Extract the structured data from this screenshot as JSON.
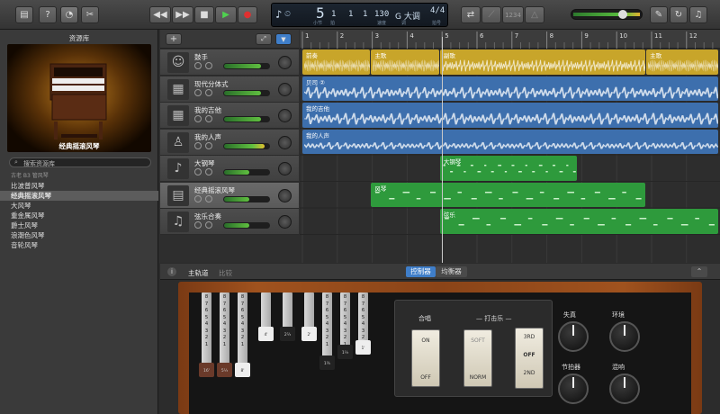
{
  "toolbar": {
    "lcd": {
      "bar": "5",
      "beat": "1",
      "div": "1",
      "tick": "1",
      "bar_label": "小节",
      "beat_label": "拍",
      "tempo": "130",
      "tempo_label": "速度",
      "key": "G 大调",
      "key_label": "调",
      "signature": "4/4",
      "signature_label": "拍号"
    },
    "count_in": "1234"
  },
  "library": {
    "title": "资源库",
    "preview_name": "经典摇滚风琴",
    "search_placeholder": "搜索资源库",
    "breadcrumb": "古老 B3 管风琴",
    "items": [
      "比波普风琴",
      "经典摇滚风琴",
      "大风琴",
      "重金属风琴",
      "爵士风琴",
      "浪潮色风琴",
      "音轮风琴"
    ],
    "selected_index": 1
  },
  "tracks": [
    {
      "name": "鼓手",
      "icon": "drummer-icon",
      "level": 0.82
    },
    {
      "name": "现代分体式",
      "icon": "amp-icon",
      "level": 0.82
    },
    {
      "name": "我的吉他",
      "icon": "amp-icon",
      "level": 0.82
    },
    {
      "name": "我的人声",
      "icon": "mic-icon",
      "level": 0.9
    },
    {
      "name": "大钢琴",
      "icon": "piano-icon",
      "level": 0.55
    },
    {
      "name": "经典摇滚风琴",
      "icon": "organ-icon",
      "level": 0.55
    },
    {
      "name": "弦乐合奏",
      "icon": "strings-icon",
      "level": 0.55
    }
  ],
  "ruler": [
    "1",
    "2",
    "3",
    "4",
    "5",
    "6",
    "7",
    "8",
    "9",
    "10",
    "11",
    "12"
  ],
  "regions": [
    {
      "label": "前奏",
      "track": 0,
      "color": "#c8a52a"
    },
    {
      "label": "主歌",
      "track": 0,
      "color": "#c8a52a"
    },
    {
      "label": "副歌",
      "track": 0,
      "color": "#c8a52a"
    },
    {
      "label": "主歌",
      "track": 0,
      "color": "#c8a52a"
    },
    {
      "label": "贝司 ②",
      "track": 1,
      "color": "#3d6fad"
    },
    {
      "label": "我的吉他",
      "track": 2,
      "color": "#3d6fad"
    },
    {
      "label": "我的人声",
      "track": 3,
      "color": "#3d6fad"
    },
    {
      "label": "大钢琴",
      "track": 4,
      "color": "#2e9a3c"
    },
    {
      "label": "风琴",
      "track": 5,
      "color": "#2e9a3c"
    },
    {
      "label": "弦乐",
      "track": 6,
      "color": "#2e9a3c"
    }
  ],
  "editor": {
    "tabs": [
      "主轨道",
      "比较"
    ],
    "controls_tab": "控制器",
    "eq_tab": "均衡器",
    "drawbar_numbers": [
      "8",
      "7",
      "6",
      "5",
      "4",
      "3",
      "2",
      "1"
    ],
    "drawbar_caps": [
      "16'",
      "5⅓",
      "8'",
      "4'",
      "2⅔",
      "2'",
      "1⅗",
      "1⅓",
      "1'"
    ],
    "percussion": {
      "chorus_label": "合唱",
      "perc_label": "打击乐",
      "chorus": [
        "ON",
        "OFF"
      ],
      "perc_a": [
        "SOFT",
        "NORM"
      ],
      "perc_b": [
        "3RD",
        "OFF",
        "2ND"
      ]
    },
    "knobs": [
      "失真",
      "环境",
      "节拍器",
      "混响"
    ]
  },
  "colors": {
    "accent": "#3f7ec9",
    "drummer": "#c8a52a",
    "audio": "#3d6fad",
    "midi": "#2e9a3c"
  }
}
